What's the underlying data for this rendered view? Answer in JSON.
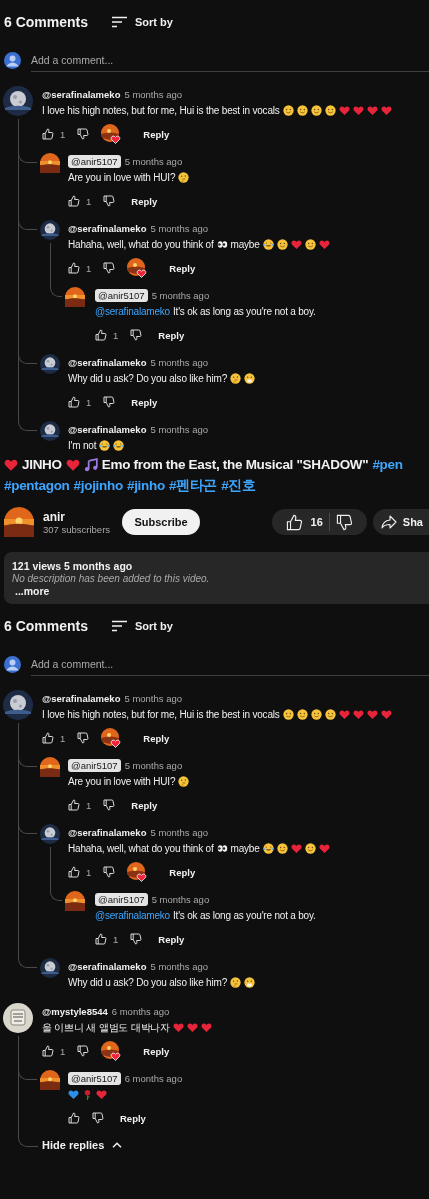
{
  "sections": [
    {
      "kind": "comments",
      "count_label": "6 Comments",
      "sort_label": "Sort by",
      "add_placeholder": "Add a comment...",
      "comments": [
        {
          "author": "@serafinalameko",
          "creator": false,
          "time": "5 months ago",
          "avatar": {
            "kind": "moon"
          },
          "body": [
            {
              "kind": "text",
              "text": "I love his high notes, but for me, Hui is the best in vocals"
            },
            {
              "kind": "smile"
            },
            {
              "kind": "smile"
            },
            {
              "kind": "smile"
            },
            {
              "kind": "smile"
            },
            {
              "kind": "heart"
            },
            {
              "kind": "heart"
            },
            {
              "kind": "heart"
            },
            {
              "kind": "heart"
            }
          ],
          "likes": "1",
          "hearted": true,
          "reply": "Reply",
          "replies": [
            {
              "author": "@anir5107",
              "creator": true,
              "time": "5 months ago",
              "avatar": {
                "kind": "sunset"
              },
              "body": [
                {
                  "kind": "text",
                  "text": "Are you in love with HUI?"
                },
                {
                  "kind": "think"
                }
              ],
              "likes": "1",
              "hearted": false,
              "reply": "Reply"
            },
            {
              "author": "@serafinalameko",
              "creator": false,
              "time": "5 months ago",
              "avatar": {
                "kind": "moon"
              },
              "body": [
                {
                  "kind": "text",
                  "text": "Hahaha, well, what do you think of"
                },
                {
                  "kind": "eyes"
                },
                {
                  "kind": "text",
                  "text": "maybe"
                },
                {
                  "kind": "laugh"
                },
                {
                  "kind": "smile"
                },
                {
                  "kind": "heart"
                },
                {
                  "kind": "smile"
                },
                {
                  "kind": "heart"
                }
              ],
              "likes": "1",
              "hearted": true,
              "reply": "Reply",
              "replies": [
                {
                  "author": "@anir5107",
                  "creator": true,
                  "time": "5 months ago",
                  "avatar": {
                    "kind": "sunset"
                  },
                  "body": [
                    {
                      "kind": "mention",
                      "text": "@serafinalameko"
                    },
                    {
                      "kind": "text",
                      "text": "It's ok as long as you're not a boy."
                    }
                  ],
                  "likes": "1",
                  "hearted": false,
                  "reply": "Reply"
                }
              ]
            },
            {
              "author": "@serafinalameko",
              "creator": false,
              "time": "5 months ago",
              "avatar": {
                "kind": "moon"
              },
              "body": [
                {
                  "kind": "text",
                  "text": "Why did u ask? Do you also like him?"
                },
                {
                  "kind": "think"
                },
                {
                  "kind": "hand_face"
                }
              ],
              "likes": "1",
              "hearted": false,
              "reply": "Reply"
            },
            {
              "author": "@serafinalameko",
              "creator": false,
              "time": "5 months ago",
              "avatar": {
                "kind": "moon"
              },
              "body": [
                {
                  "kind": "text",
                  "text": "I'm not"
                },
                {
                  "kind": "laugh"
                },
                {
                  "kind": "laugh"
                }
              ],
              "truncated": true
            }
          ]
        }
      ]
    },
    {
      "kind": "video",
      "title_lines": [
        [
          {
            "kind": "heart"
          },
          {
            "kind": "text",
            "text": "JINHO"
          },
          {
            "kind": "heart"
          },
          {
            "kind": "music"
          },
          {
            "kind": "text",
            "text": "Emo from the East, the Musical \"SHADOW\""
          },
          {
            "kind": "hashtag",
            "text": "#pen"
          }
        ],
        [
          {
            "kind": "hashtag",
            "text": "#pentagon"
          },
          {
            "kind": "hashtag",
            "text": "#jojinho"
          },
          {
            "kind": "hashtag",
            "text": "#jinho"
          },
          {
            "kind": "hashtag",
            "text": "#펜타곤"
          },
          {
            "kind": "hashtag",
            "text": "#진호"
          }
        ]
      ],
      "channel": {
        "name": "anir",
        "subscribers": "307 subscribers",
        "subscribe": "Subscribe"
      },
      "likes": "16",
      "share": "Sha",
      "description": {
        "stats": "121 views  5 months ago",
        "text": "No description has been added to this video.",
        "more": "...more"
      }
    },
    {
      "kind": "comments",
      "count_label": "6 Comments",
      "sort_label": "Sort by",
      "add_placeholder": "Add a comment...",
      "comments": [
        {
          "author": "@serafinalameko",
          "creator": false,
          "time": "5 months ago",
          "avatar": {
            "kind": "moon"
          },
          "body": [
            {
              "kind": "text",
              "text": "I love his high notes, but for me, Hui is the best in vocals"
            },
            {
              "kind": "smile"
            },
            {
              "kind": "smile"
            },
            {
              "kind": "smile"
            },
            {
              "kind": "smile"
            },
            {
              "kind": "heart"
            },
            {
              "kind": "heart"
            },
            {
              "kind": "heart"
            },
            {
              "kind": "heart"
            }
          ],
          "likes": "1",
          "hearted": true,
          "reply": "Reply",
          "replies": [
            {
              "author": "@anir5107",
              "creator": true,
              "time": "5 months ago",
              "avatar": {
                "kind": "sunset"
              },
              "body": [
                {
                  "kind": "text",
                  "text": "Are you in love with HUI?"
                },
                {
                  "kind": "think"
                }
              ],
              "likes": "1",
              "hearted": false,
              "reply": "Reply"
            },
            {
              "author": "@serafinalameko",
              "creator": false,
              "time": "5 months ago",
              "avatar": {
                "kind": "moon"
              },
              "body": [
                {
                  "kind": "text",
                  "text": "Hahaha, well, what do you think of"
                },
                {
                  "kind": "eyes"
                },
                {
                  "kind": "text",
                  "text": "maybe"
                },
                {
                  "kind": "laugh"
                },
                {
                  "kind": "smile"
                },
                {
                  "kind": "heart"
                },
                {
                  "kind": "smile"
                },
                {
                  "kind": "heart"
                }
              ],
              "likes": "1",
              "hearted": true,
              "reply": "Reply",
              "replies": [
                {
                  "author": "@anir5107",
                  "creator": true,
                  "time": "5 months ago",
                  "avatar": {
                    "kind": "sunset"
                  },
                  "body": [
                    {
                      "kind": "mention",
                      "text": "@serafinalameko"
                    },
                    {
                      "kind": "text",
                      "text": "It's ok as long as you're not a boy."
                    }
                  ],
                  "likes": "1",
                  "hearted": false,
                  "reply": "Reply"
                }
              ]
            },
            {
              "author": "@serafinalameko",
              "creator": false,
              "time": "5 months ago",
              "avatar": {
                "kind": "moon"
              },
              "body": [
                {
                  "kind": "text",
                  "text": "Why did u ask? Do you also like him?"
                },
                {
                  "kind": "think"
                },
                {
                  "kind": "hand_face"
                }
              ],
              "truncated": true
            }
          ]
        },
        {
          "author": "@mystyle8544",
          "creator": false,
          "time": "6 months ago",
          "avatar": {
            "kind": "sticker"
          },
          "body": [
            {
              "kind": "text",
              "text": "울 이쁘니 새 앨범도 대박나자"
            },
            {
              "kind": "heart"
            },
            {
              "kind": "heart"
            },
            {
              "kind": "heart"
            }
          ],
          "likes": "1",
          "hearted": true,
          "reply": "Reply",
          "hide_replies": "Hide replies",
          "replies": [
            {
              "author": "@anir5107",
              "creator": true,
              "time": "6 months ago",
              "avatar": {
                "kind": "sunset"
              },
              "body": [
                {
                  "kind": "blue_heart"
                },
                {
                  "kind": "rose"
                },
                {
                  "kind": "heart"
                }
              ],
              "hearted": false,
              "reply": "Reply"
            }
          ]
        }
      ]
    }
  ]
}
